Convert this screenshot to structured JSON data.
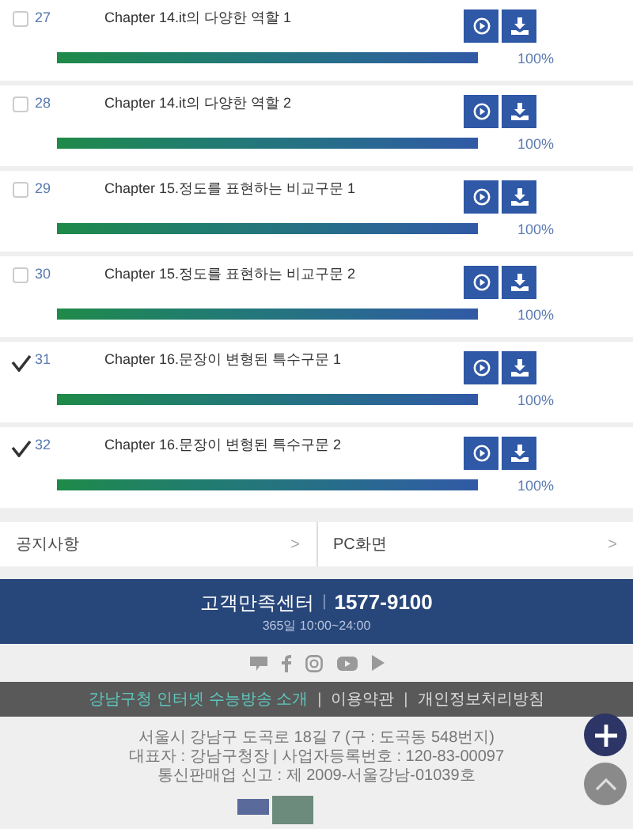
{
  "lectures": [
    {
      "checked": false,
      "number": "27",
      "title": "Chapter 14.it의 다양한 역할 1",
      "level": 1,
      "percent": "100%"
    },
    {
      "checked": false,
      "number": "28",
      "title": "Chapter 14.it의 다양한 역할 2",
      "level": 1,
      "percent": "100%"
    },
    {
      "checked": false,
      "number": "29",
      "title": "Chapter 15.정도를 표현하는 비교구문 1",
      "level": 1,
      "percent": "100%"
    },
    {
      "checked": false,
      "number": "30",
      "title": "Chapter 15.정도를 표현하는 비교구문 2",
      "level": 1,
      "percent": "100%"
    },
    {
      "checked": true,
      "number": "31",
      "title": "Chapter 16.문장이 변형된 특수구문 1",
      "level": 1,
      "percent": "100%"
    },
    {
      "checked": true,
      "number": "32",
      "title": "Chapter 16.문장이 변형된 특수구문 2",
      "level": 1,
      "percent": "100%"
    }
  ],
  "nav_links": [
    {
      "label": "공지사항",
      "arrow": ">"
    },
    {
      "label": "PC화면",
      "arrow": ">"
    }
  ],
  "call_center": {
    "label": "고객만족센터",
    "separator": "|",
    "phone": "1577-9100",
    "hours": "365일 10:00~24:00"
  },
  "footer_links": [
    {
      "label": "강남구청 인터넷 수능방송 소개",
      "highlighted": true
    },
    {
      "label": "이용약관",
      "highlighted": false
    },
    {
      "label": "개인정보처리방침",
      "highlighted": false
    }
  ],
  "footer_separator": "|",
  "address_lines": [
    "서울시 강남구 도곡로 18길 7 (구 : 도곡동 548번지)",
    "대표자 : 강남구청장 | 사업자등록번호 : 120-83-00097",
    "통신판매업 신고 : 제 2009-서울강남-01039호"
  ]
}
